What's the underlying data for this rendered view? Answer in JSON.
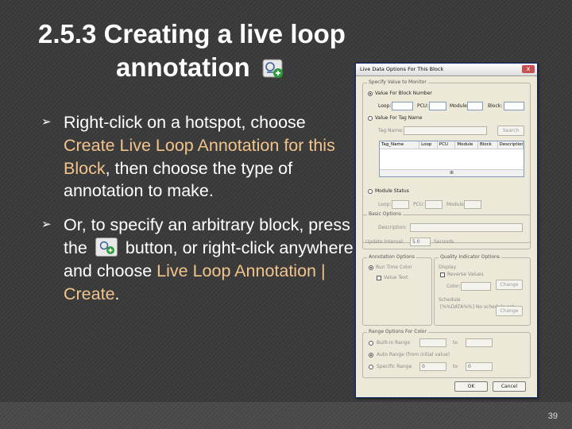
{
  "slide": {
    "title_line1": "2.5.3  Creating a live loop",
    "title_line2": "annotation",
    "page_number": "39"
  },
  "bullets": [
    {
      "text_before": "Right-click on a hotspot, choose ",
      "highlight": "Create Live Loop Annotation for this Block",
      "text_after": ", then choose the type of annotation to make."
    },
    {
      "text_before": "Or, to specify an arbitrary block, press the",
      "text_middle": "button, or right-click anywhere and choose ",
      "highlight": "Live Loop Annotation | Create",
      "text_after": "."
    }
  ],
  "dialog": {
    "title": "Live Data Options For This Block",
    "close": "x",
    "specify_group": "Specify Value to Monitor",
    "value_for_block_number": "Value For Block Number",
    "loop": "Loop:",
    "pcu": "PCU:",
    "module": "Module:",
    "block": "Block:",
    "value_for_tag_name": "Value For Tag Name",
    "tag_name": "Tag Name:",
    "search": "Search",
    "table_headers": [
      "Tag_Name",
      "Loop",
      "PCU",
      "Module",
      "Block",
      "Description"
    ],
    "scroll_thumb": "III",
    "module_status": "Module Status",
    "status_loop": "Loop:",
    "status_pcu": "PCU:",
    "status_module": "Module:",
    "basic_group": "Basic Options",
    "description": "Description:",
    "update_interval": "Update Interval:",
    "interval_value": "5.0",
    "seconds": "Seconds",
    "annotation_group": "Annotation Options",
    "run_time_color": "Run Time Color",
    "value_text": "Value Text",
    "quality_group": "Quality Indicator Options",
    "display": "Display",
    "reverse_values": "Reverse Values",
    "color": "Color:",
    "change1": "Change",
    "schedule": "Schedule",
    "schedule_value": "[%%DATA%%] No schedule set",
    "change2": "Change",
    "range_group": "Range Options For Color",
    "built_in_range": "Built-in Range",
    "auto_range": "Auto Range (from initial value)",
    "specific_range": "Specific Range",
    "to": "to",
    "range_min": "0",
    "range_max": "0",
    "ok": "OK",
    "cancel": "Cancel"
  },
  "colors": {
    "background": "#3a3a3a",
    "highlight_text": "#f2c48c",
    "dialog_face": "#ece9d8"
  },
  "icons": [
    "arrow-bullet-icon",
    "annotation-icon",
    "close-icon"
  ]
}
